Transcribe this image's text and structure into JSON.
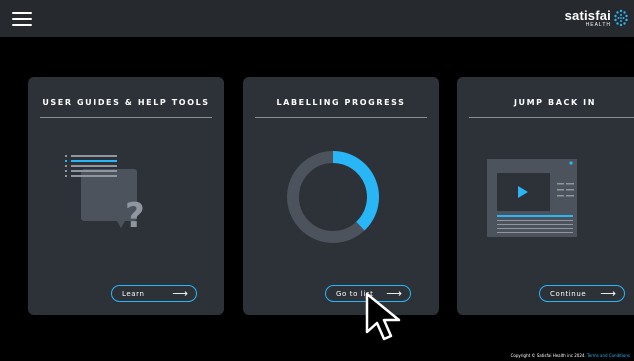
{
  "header": {
    "logo_main": "satisfai",
    "logo_sub": "HEALTH"
  },
  "cards": [
    {
      "title": "USER GUIDES & HELP TOOLS",
      "button_label": "Learn"
    },
    {
      "title": "LABELLING PROGRESS",
      "button_label": "Go to list",
      "progress_fraction": 0.38
    },
    {
      "title": "JUMP BACK IN",
      "button_label": "Continue"
    }
  ],
  "footer": {
    "copyright": "Copyright © Satisfai Health inc 2024.",
    "terms_link": "Terms and Conditions"
  },
  "colors": {
    "accent": "#29b6f6",
    "card_bg": "#2d3138",
    "topbar_bg": "#26292e",
    "page_bg": "#000000"
  },
  "icons": {
    "menu": "hamburger-menu-icon",
    "arrow": "arrow-right-icon",
    "help": "help-document-icon",
    "video": "video-player-icon",
    "cursor": "mouse-pointer-icon"
  }
}
